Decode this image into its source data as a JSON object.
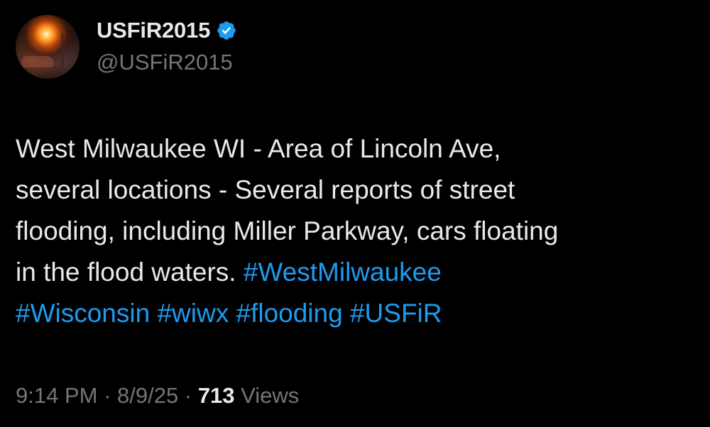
{
  "author": {
    "display_name": "USFiR2015",
    "handle": "@USFiR2015",
    "verified": true,
    "verified_badge_color": "#1d9bf0"
  },
  "tweet": {
    "text_lines": [
      "West Milwaukee WI - Area of Lincoln Ave,",
      "several locations - Several reports of street",
      "flooding, including Miller Parkway, cars floating",
      "in the flood waters. "
    ],
    "hashtags": [
      "#WestMilwaukee",
      "#Wisconsin",
      "#wiwx",
      "#flooding",
      "#USFiR"
    ],
    "hashtag_color": "#1d9bf0"
  },
  "meta": {
    "time": "9:14 PM",
    "separator": "·",
    "date": "8/9/25",
    "views_count": "713",
    "views_label": "Views"
  }
}
